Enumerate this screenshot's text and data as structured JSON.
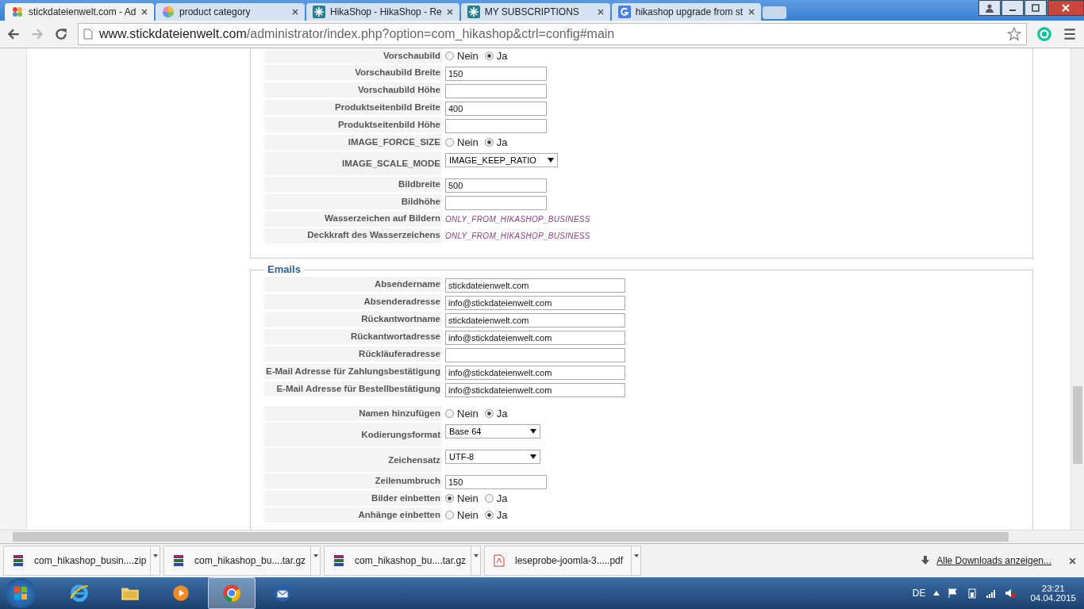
{
  "tabs": [
    {
      "title": "stickdateienwelt.com - Ad",
      "selected": true
    },
    {
      "title": "product category",
      "selected": false
    },
    {
      "title": "HikaShop - HikaShop - Re",
      "selected": false
    },
    {
      "title": "MY SUBSCRIPTIONS",
      "selected": false
    },
    {
      "title": "hikashop upgrade from st",
      "selected": false
    }
  ],
  "address": {
    "host": "www.stickdateienwelt.com",
    "path": "/administrator/index.php?option=com_hikashop&ctrl=config#main"
  },
  "images_section": {
    "groups": [
      {
        "rows": [
          {
            "label": "Vorschaubild",
            "kind": "radio",
            "options": [
              {
                "label": "Nein",
                "selected": false
              },
              {
                "label": "Ja",
                "selected": true
              }
            ]
          },
          {
            "label": "Vorschaubild Breite",
            "kind": "text",
            "value": "150"
          },
          {
            "label": "Vorschaubild Höhe",
            "kind": "text"
          },
          {
            "label": "Produktseitenbild Breite",
            "kind": "text",
            "value": "400"
          },
          {
            "label": "Produktseitenbild Höhe",
            "kind": "text"
          },
          {
            "label": "IMAGE_FORCE_SIZE",
            "kind": "radio",
            "options": [
              {
                "label": "Nein",
                "selected": false
              },
              {
                "label": "Ja",
                "selected": true
              }
            ]
          },
          {
            "label": "IMAGE_SCALE_MODE",
            "kind": "select",
            "value": "IMAGE_KEEP_RATIO"
          },
          {
            "label": "Bildbreite",
            "kind": "text",
            "value": "500"
          },
          {
            "label": "Bildhöhe",
            "kind": "text"
          },
          {
            "label": "Wasserzeichen auf Bildern",
            "kind": "note",
            "value": "ONLY_FROM_HIKASHOP_BUSINESS"
          },
          {
            "label": "Deckkraft des Wasserzeichens",
            "kind": "note",
            "value": "ONLY_FROM_HIKASHOP_BUSINESS"
          }
        ]
      }
    ]
  },
  "emails_section": {
    "legend": "Emails",
    "groups": [
      {
        "rows": [
          {
            "label": "Absendername",
            "kind": "email",
            "value": "stickdateienwelt.com"
          },
          {
            "label": "Absenderadresse",
            "kind": "email",
            "value": "info@stickdateienwelt.com"
          },
          {
            "label": "Rückantwortname",
            "kind": "email",
            "value": "stickdateienwelt.com"
          },
          {
            "label": "Rückantwortadresse",
            "kind": "email",
            "value": "info@stickdateienwelt.com"
          },
          {
            "label": "Rückläuferadresse",
            "kind": "email"
          },
          {
            "label": "E-Mail Adresse für Zahlungsbestätigung",
            "kind": "email",
            "value": "info@stickdateienwelt.com"
          },
          {
            "label": "E-Mail Adresse für Bestellbestätigung",
            "kind": "email",
            "value": "info@stickdateienwelt.com"
          }
        ]
      },
      {
        "rows": [
          {
            "label": "Namen hinzufügen",
            "kind": "radio",
            "options": [
              {
                "label": "Nein",
                "selected": false
              },
              {
                "label": "Ja",
                "selected": true
              }
            ]
          },
          {
            "label": "Kodierungsformat",
            "kind": "select",
            "value": "Base 64"
          },
          {
            "label": "Zeichensatz",
            "kind": "select",
            "value": "UTF-8"
          },
          {
            "label": "Zeilenumbruch",
            "kind": "text",
            "value": "150"
          },
          {
            "label": "Bilder einbetten",
            "kind": "radio",
            "options": [
              {
                "label": "Nein",
                "selected": true
              },
              {
                "label": "Ja",
                "selected": false
              }
            ]
          },
          {
            "label": "Anhänge einbetten",
            "kind": "radio",
            "options": [
              {
                "label": "Nein",
                "selected": false
              },
              {
                "label": "Ja",
                "selected": true
              }
            ]
          }
        ]
      }
    ]
  },
  "downloads": {
    "items": [
      {
        "name": "com_hikashop_busin....zip",
        "kind": "archive"
      },
      {
        "name": "com_hikashop_bu....tar.gz",
        "kind": "archive"
      },
      {
        "name": "com_hikashop_bu....tar.gz",
        "kind": "archive"
      },
      {
        "name": "leseprobe-joomla-3.....pdf",
        "kind": "pdf"
      }
    ],
    "show_all": "Alle Downloads anzeigen..."
  },
  "taskbar": {
    "apps": [
      {
        "selected": false
      },
      {
        "selected": false
      },
      {
        "selected": false
      },
      {
        "selected": true
      },
      {
        "selected": false
      }
    ],
    "language": "DE",
    "time": "23:21",
    "date": "04.04.2015"
  }
}
